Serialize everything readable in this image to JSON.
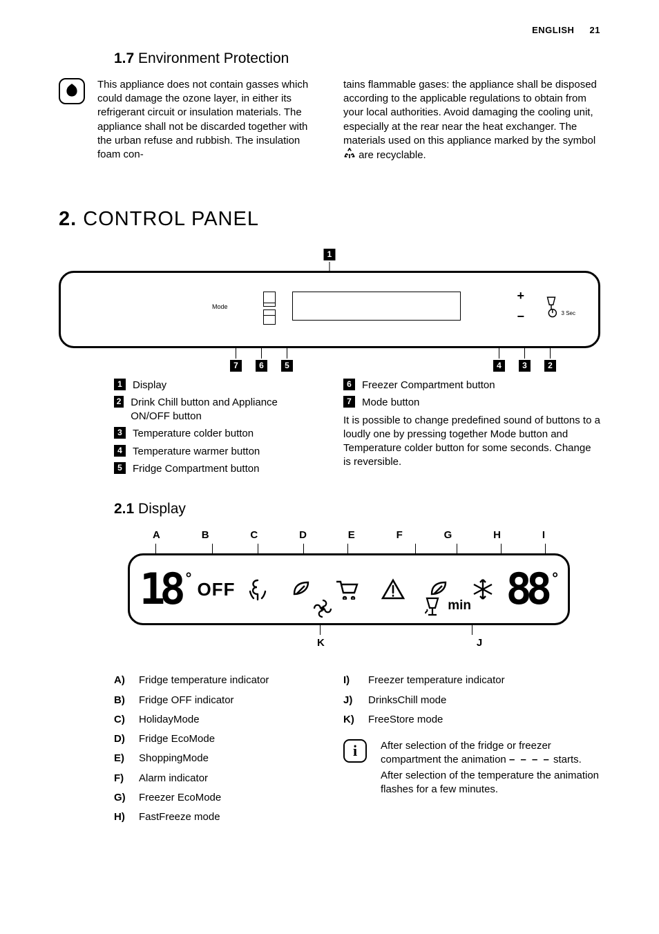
{
  "header": {
    "lang": "ENGLISH",
    "page_num": "21"
  },
  "section17": {
    "num": "1.7",
    "title": "Environment Protection",
    "paragraph_left": "This appliance does not contain gasses which could damage the ozone layer, in either its refrigerant circuit or insulation materials. The appliance shall not be discarded together with the urban refuse and rubbish. The insulation foam con-",
    "paragraph_right_a": "tains flammable gases: the appliance shall be disposed according to the applicable regulations to obtain from your local authorities. Avoid damaging the cooling unit, especially at the rear near the heat exchanger. The materials used on this appliance marked by the symbol ",
    "paragraph_right_b": " are recyclable."
  },
  "section2": {
    "num": "2.",
    "title": "CONTROL PANEL"
  },
  "panel_labels": {
    "mode": "Mode",
    "threesec": "3 Sec"
  },
  "callouts": {
    "top": "1",
    "bl": [
      "7",
      "6",
      "5"
    ],
    "br": [
      "4",
      "3",
      "2"
    ]
  },
  "legend_left": [
    {
      "n": "1",
      "t": "Display"
    },
    {
      "n": "2",
      "t": "Drink Chill button and Appliance ON/OFF button"
    },
    {
      "n": "3",
      "t": "Temperature colder button"
    },
    {
      "n": "4",
      "t": "Temperature warmer button"
    },
    {
      "n": "5",
      "t": "Fridge Compartment button"
    }
  ],
  "legend_right": [
    {
      "n": "6",
      "t": "Freezer Compartment button"
    },
    {
      "n": "7",
      "t": "Mode button"
    }
  ],
  "legend_para": "It is possible to change predefined sound of buttons to a loudly one by pressing together Mode button and Temperature colder button for some seconds. Change is reversible.",
  "section21": {
    "num": "2.1",
    "title": "Display"
  },
  "disp_letters_top": [
    "A",
    "B",
    "C",
    "D",
    "E",
    "F",
    "G",
    "H",
    "I"
  ],
  "disp_letters_bottom": [
    "K",
    "J"
  ],
  "disp_text": {
    "off": "OFF",
    "min": "min"
  },
  "ak_left": [
    {
      "l": "A)",
      "t": "Fridge temperature indicator"
    },
    {
      "l": "B)",
      "t": "Fridge OFF indicator"
    },
    {
      "l": "C)",
      "t": "HolidayMode"
    },
    {
      "l": "D)",
      "t": "Fridge EcoMode"
    },
    {
      "l": "E)",
      "t": "ShoppingMode"
    },
    {
      "l": "F)",
      "t": "Alarm indicator"
    },
    {
      "l": "G)",
      "t": "Freezer EcoMode"
    },
    {
      "l": "H)",
      "t": "FastFreeze mode"
    }
  ],
  "ak_right": [
    {
      "l": "I)",
      "t": "Freezer temperature indicator"
    },
    {
      "l": "J)",
      "t": "DrinksChill mode"
    },
    {
      "l": "K)",
      "t": "FreeStore mode"
    }
  ],
  "info": {
    "p1a": "After selection of the fridge or freezer compartment the animation ",
    "dashes": "– – – –",
    "p1b": " starts.",
    "p2": "After selection of the temperature the animation flashes for a few minutes."
  }
}
